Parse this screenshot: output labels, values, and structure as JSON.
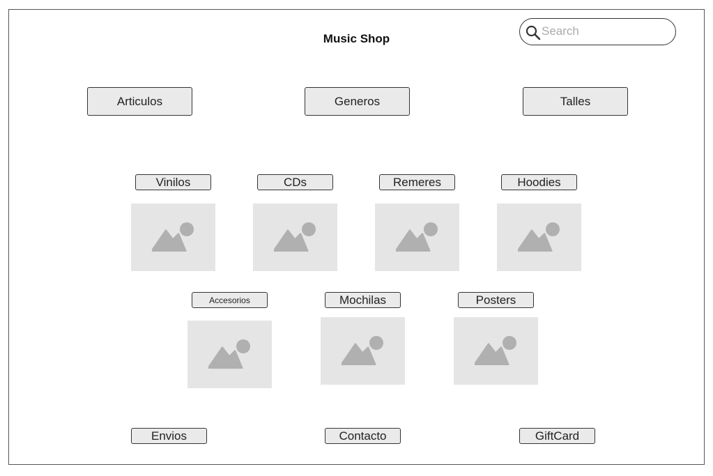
{
  "header": {
    "title": "Music Shop",
    "search": {
      "placeholder": "Search",
      "value": ""
    }
  },
  "nav": {
    "articulos": "Articulos",
    "generos": "Generos",
    "talles": "Talles"
  },
  "categories": {
    "vinilos": "Vinilos",
    "cds": "CDs",
    "remeres": "Remeres",
    "hoodies": "Hoodies",
    "accesorios": "Accesorios",
    "mochilas": "Mochilas",
    "posters": "Posters"
  },
  "footer": {
    "envios": "Envios",
    "contacto": "Contacto",
    "giftcard": "GiftCard"
  },
  "icons": {
    "search": "magnifier-icon",
    "placeholder_image": "image-placeholder-icon"
  },
  "colors": {
    "button_bg": "#eaeaea",
    "image_bg": "#e5e5e5",
    "image_icon": "#b0b0b0",
    "border": "#333333"
  }
}
